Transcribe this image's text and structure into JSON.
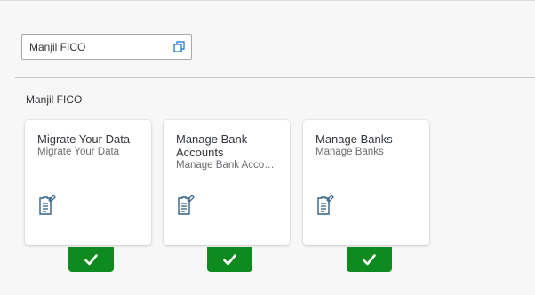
{
  "search": {
    "value": "Manjil FICO"
  },
  "group": {
    "title": "Manjil FICO"
  },
  "tiles": [
    {
      "title": "Migrate Your Data",
      "subtitle": "Migrate Your Data",
      "icon": "document-edit-icon",
      "status": "check-icon"
    },
    {
      "title": "Manage Bank Accounts",
      "subtitle": "Manage Bank Accou...",
      "icon": "document-edit-icon",
      "status": "check-icon"
    },
    {
      "title": "Manage Banks",
      "subtitle": "Manage Banks",
      "icon": "document-edit-icon",
      "status": "check-icon"
    }
  ],
  "colors": {
    "accent": "#0a6ed1",
    "icon": "#346187",
    "status_ok": "#0f8a1f",
    "background": "#f7f7f7"
  }
}
